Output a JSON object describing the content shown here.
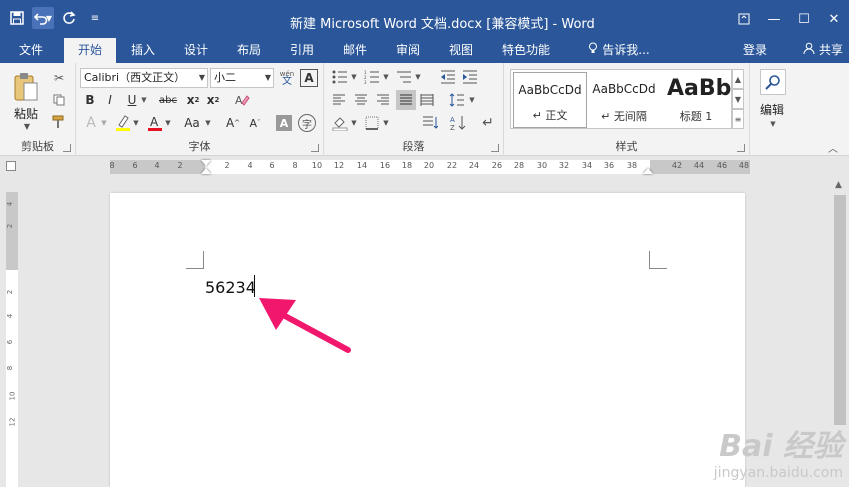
{
  "titlebar": {
    "title": "新建 Microsoft Word 文档.docx [兼容模式] - Word",
    "bg": "#2b579a",
    "qat": [
      "save-icon",
      "undo-icon",
      "redo-icon",
      "customize-icon"
    ]
  },
  "tabs": [
    {
      "label": "文件"
    },
    {
      "label": "开始"
    },
    {
      "label": "插入"
    },
    {
      "label": "设计"
    },
    {
      "label": "布局"
    },
    {
      "label": "引用"
    },
    {
      "label": "邮件"
    },
    {
      "label": "审阅"
    },
    {
      "label": "视图"
    },
    {
      "label": "特色功能"
    },
    {
      "label": "告诉我..."
    }
  ],
  "active_tab": "开始",
  "account": {
    "login": "登录",
    "share": "共享"
  },
  "ribbon": {
    "clipboard": {
      "label": "剪贴板",
      "paste_label": "粘贴"
    },
    "font": {
      "label": "字体",
      "font_name": "Calibri（西文正文）",
      "font_size": "小二",
      "phonetic_char": "wén",
      "highlight_color": "#ffff00",
      "font_color": "#e81123"
    },
    "paragraph": {
      "label": "段落"
    },
    "styles": {
      "label": "样式",
      "items": [
        {
          "sample": "AaBbCcDd",
          "name": "↵ 正文"
        },
        {
          "sample": "AaBbCcDd",
          "name": "↵ 无间隔"
        },
        {
          "sample": "AaBb",
          "name": "标题 1"
        }
      ]
    },
    "editing": {
      "label": "编辑"
    }
  },
  "ruler": {
    "numbers": [
      "8",
      "6",
      "4",
      "2",
      "2",
      "4",
      "6",
      "8",
      "10",
      "12",
      "14",
      "16",
      "18",
      "20",
      "22",
      "24",
      "26",
      "28",
      "30",
      "32",
      "34",
      "36",
      "38",
      "42",
      "44",
      "46",
      "48"
    ],
    "vnumbers": [
      "4",
      "2",
      "2",
      "4",
      "6",
      "8",
      "10",
      "12"
    ]
  },
  "document": {
    "text": "56234"
  },
  "annotation": {
    "arrow_color": "#f0176d"
  },
  "watermark": {
    "logo": "Bai 经验",
    "url": "jingyan.baidu.com"
  }
}
